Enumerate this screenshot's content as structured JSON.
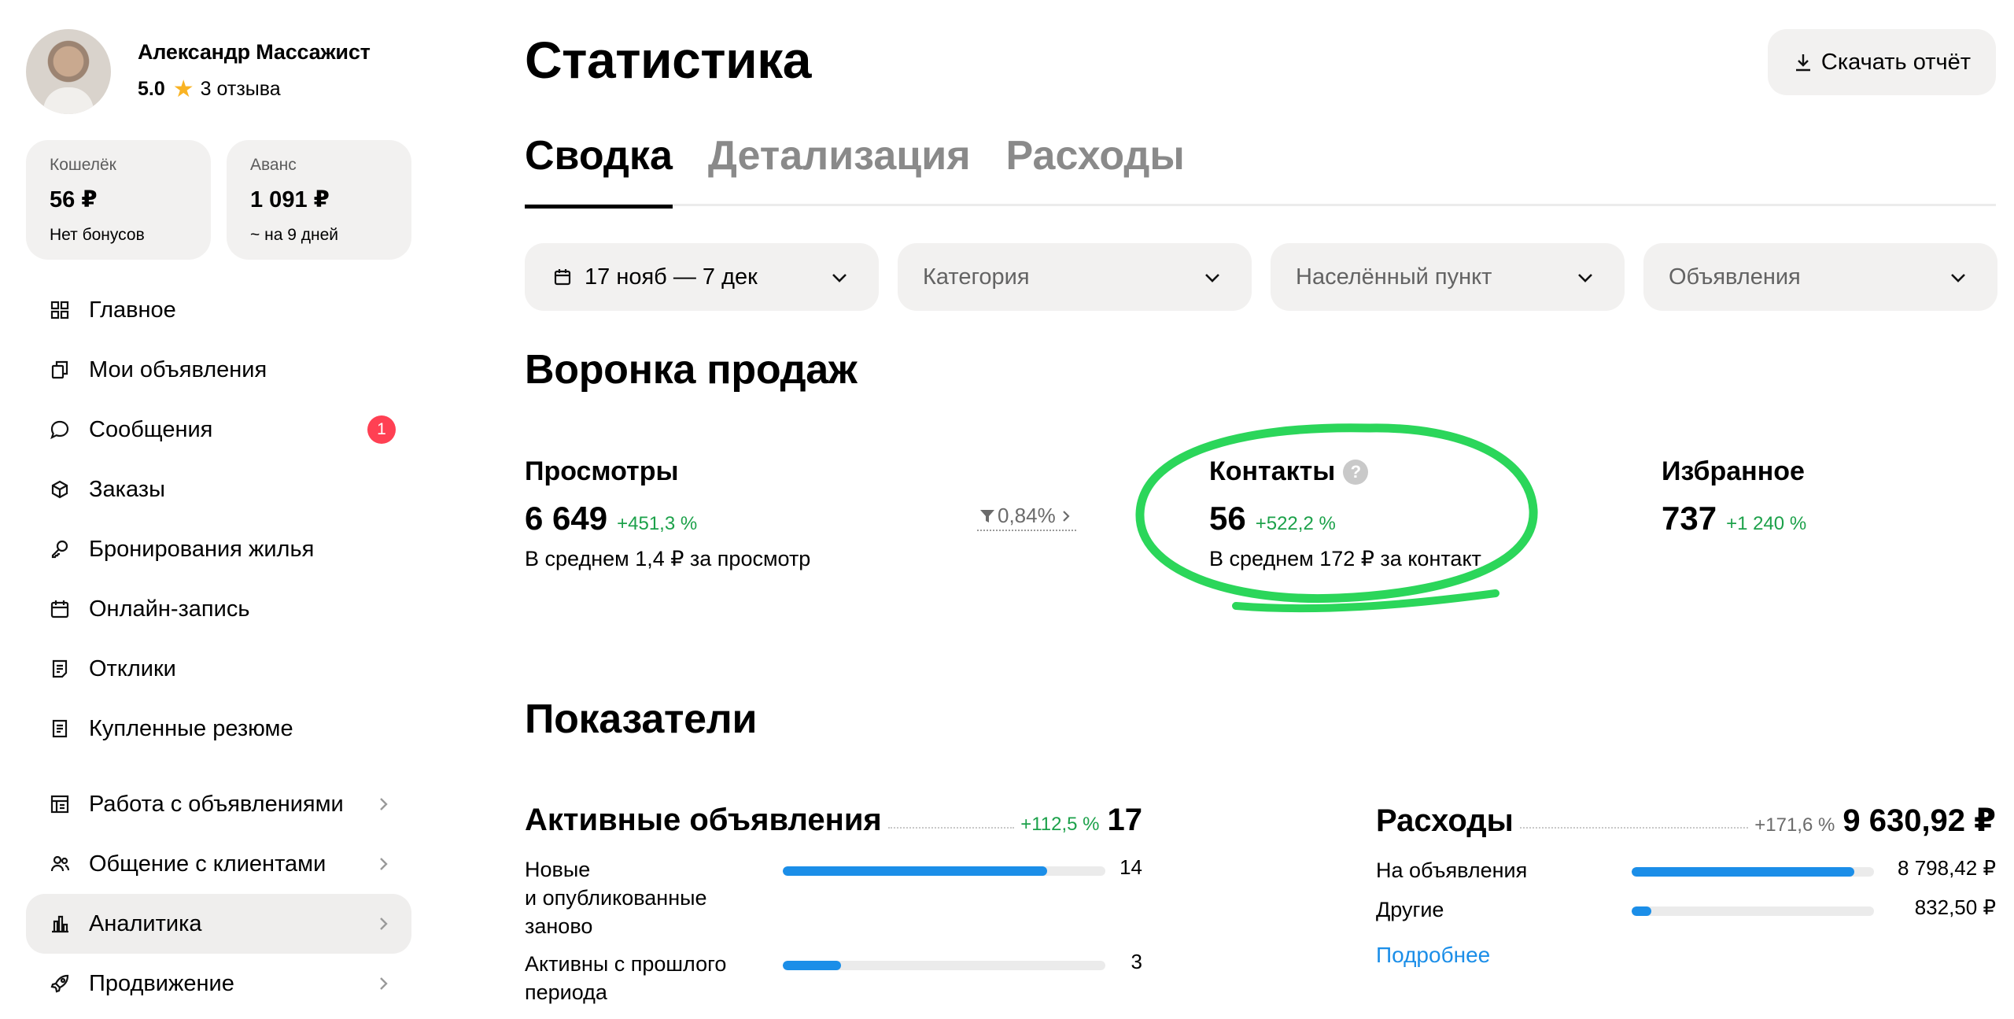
{
  "profile": {
    "name": "Александр Массажист",
    "rating": "5.0",
    "reviews": "3 отзыва",
    "star_icon": "star-icon",
    "star_color": "#f9b323"
  },
  "wallets": [
    {
      "label": "Кошелёк",
      "amount": "56 ₽",
      "note": "Нет бонусов"
    },
    {
      "label": "Аванс",
      "amount": "1 091 ₽",
      "note": "~ на 9 дней"
    }
  ],
  "menu": {
    "items": [
      {
        "label": "Главное",
        "icon": "grid-icon"
      },
      {
        "label": "Мои объявления",
        "icon": "copy-icon"
      },
      {
        "label": "Сообщения",
        "icon": "chat-icon",
        "badge": "1"
      },
      {
        "label": "Заказы",
        "icon": "box-icon"
      },
      {
        "label": "Бронирования жилья",
        "icon": "key-icon"
      },
      {
        "label": "Онлайн-запись",
        "icon": "calendar-icon"
      },
      {
        "label": "Отклики",
        "icon": "document-icon"
      },
      {
        "label": "Купленные резюме",
        "icon": "resume-icon"
      }
    ],
    "groups": [
      {
        "label": "Работа с объявлениями",
        "icon": "ads-work-icon"
      },
      {
        "label": "Общение с клиентами",
        "icon": "users-icon"
      },
      {
        "label": "Аналитика",
        "icon": "chart-icon",
        "active": true
      },
      {
        "label": "Продвижение",
        "icon": "rocket-icon"
      }
    ]
  },
  "header": {
    "title": "Статистика",
    "download_label": "Скачать отчёт"
  },
  "tabs": [
    {
      "label": "Сводка",
      "active": true
    },
    {
      "label": "Детализация",
      "active": false
    },
    {
      "label": "Расходы",
      "active": false
    }
  ],
  "filters": {
    "date": "17 нояб — 7 дек",
    "category": "Категория",
    "location": "Населённый пункт",
    "ads": "Объявления"
  },
  "funnel": {
    "title": "Воронка продаж",
    "views": {
      "title": "Просмотры",
      "value": "6 649",
      "delta": "+451,3 %",
      "note": "В среднем 1,4 ₽ за просмотр"
    },
    "conversion": "0,84%",
    "contacts": {
      "title": "Контакты",
      "help": "?",
      "value": "56",
      "delta": "+522,2 %",
      "note": "В среднем 172 ₽ за контакт"
    },
    "favorites": {
      "title": "Избранное",
      "value": "737",
      "delta": "+1 240 %"
    },
    "highlight_color": "#2bd65a"
  },
  "metrics": {
    "title": "Показатели",
    "active_ads": {
      "title": "Активные объявления",
      "delta": "+112,5 %",
      "total": "17",
      "rows": [
        {
          "label": "Новые\nи опубликованные\nзаново",
          "value": "14",
          "fraction": 0.82
        },
        {
          "label": "Активны с прошлого\nпериода",
          "value": "3",
          "fraction": 0.18
        }
      ]
    },
    "expenses": {
      "title": "Расходы",
      "delta": "+171,6 %",
      "total": "9 630,92 ₽",
      "rows": [
        {
          "label": "На объявления",
          "value": "8 798,42 ₽",
          "fraction": 0.92
        },
        {
          "label": "Другие",
          "value": "832,50 ₽",
          "fraction": 0.08
        }
      ],
      "more_label": "Подробнее"
    },
    "bar_color": "#1b8ee8",
    "delta_color": "#1ca14a"
  }
}
